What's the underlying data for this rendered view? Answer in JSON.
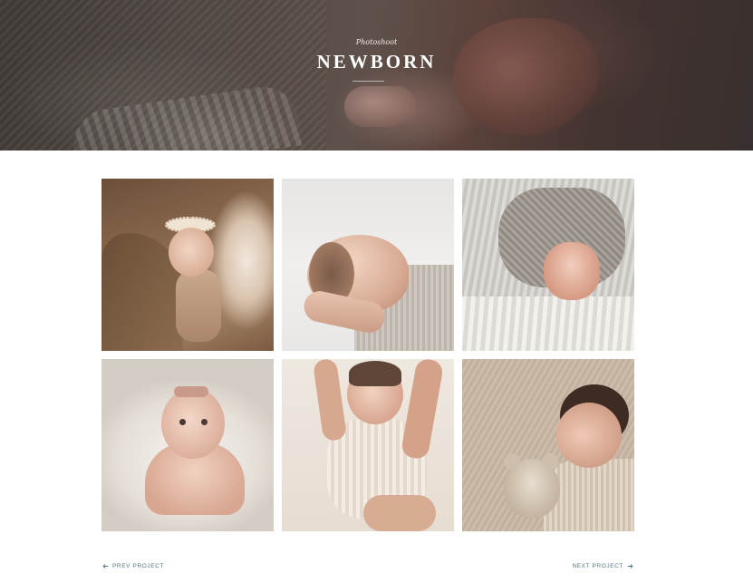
{
  "hero": {
    "subtitle": "Photoshoot",
    "title": "NEWBORN"
  },
  "gallery": {
    "tiles": [
      {
        "subject": "newborn-held-in-arms"
      },
      {
        "subject": "newborn-head-in-hand"
      },
      {
        "subject": "newborn-feet-knit"
      },
      {
        "subject": "newborn-with-bow-on-blanket"
      },
      {
        "subject": "newborn-cradled-in-hands"
      },
      {
        "subject": "newborn-sleeping-with-teddy"
      }
    ]
  },
  "pagination": {
    "prev_label": "PREV PROJECT",
    "next_label": "NEXT PROJECT",
    "prev_icon": "arrow-left-icon",
    "next_icon": "arrow-right-icon"
  },
  "colors": {
    "link": "#557585",
    "hero_text": "#ffffff"
  }
}
